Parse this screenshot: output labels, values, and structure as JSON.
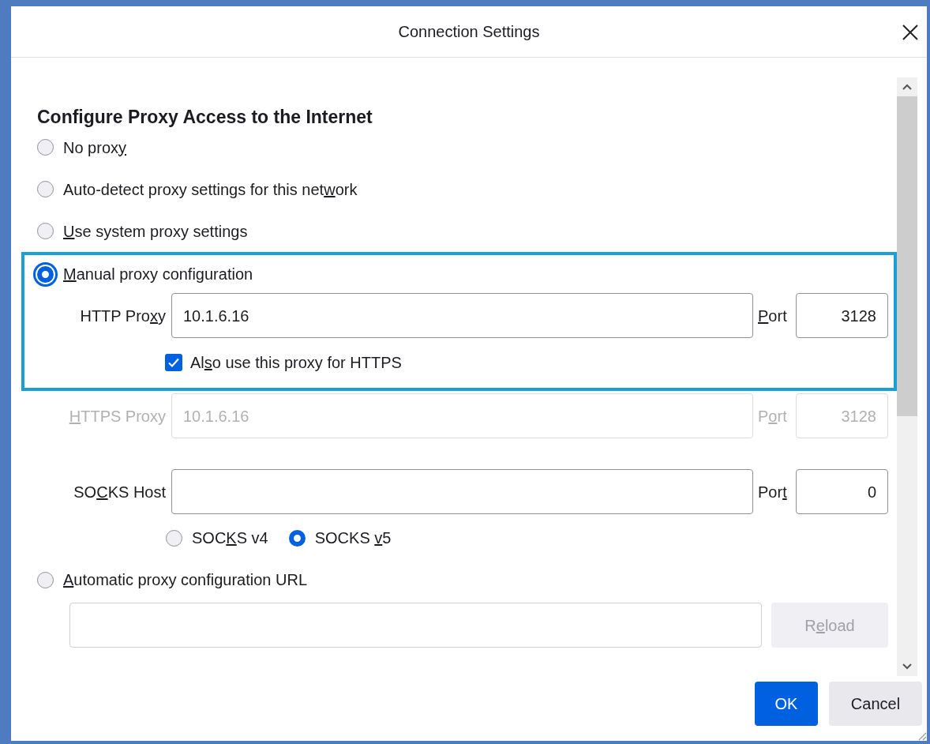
{
  "window": {
    "title": "Connection Settings"
  },
  "heading": "Configure Proxy Access to the Internet",
  "proxy_modes": [
    {
      "kind": "plain",
      "label": {
        "pre": "No prox",
        "key": "y"
      },
      "selected": false
    },
    {
      "kind": "plain",
      "label": {
        "pre": "Auto-detect proxy settings for this net",
        "key": "w",
        "post": "ork"
      },
      "selected": false
    },
    {
      "kind": "plain",
      "label": {
        "key": "U",
        "post": "se system proxy settings"
      },
      "selected": false
    },
    {
      "kind": "manual",
      "label": {
        "key": "M",
        "post": "anual proxy configuration"
      },
      "selected": true,
      "focused": true,
      "highlighted": true,
      "http_proxy": {
        "label": {
          "pre": "HTTP Pro",
          "key": "x",
          "post": "y"
        },
        "value": "10.1.6.16",
        "port_label": {
          "key": "P",
          "post": "ort"
        },
        "port": "3128"
      },
      "also_https": {
        "label": {
          "pre": "Al",
          "key": "s",
          "post": "o use this proxy for HTTPS"
        },
        "checked": true
      },
      "https_proxy": {
        "label": {
          "key": "H",
          "post": "TTPS Proxy"
        },
        "value": "10.1.6.16",
        "port_label": {
          "pre": "P",
          "key": "o",
          "post": "rt"
        },
        "port": "3128",
        "disabled": true
      },
      "socks_host": {
        "label": {
          "pre": "SO",
          "key": "C",
          "post": "KS Host"
        },
        "port_label": {
          "pre": "Por",
          "key": "t"
        },
        "port": "0"
      },
      "socks_versions": [
        {
          "label": {
            "pre": "SOC",
            "key": "K",
            "post": "S v4"
          },
          "selected": false
        },
        {
          "label": {
            "pre": "SOCKS ",
            "key": "v",
            "post": "5"
          },
          "selected": true
        }
      ]
    },
    {
      "kind": "auto_url",
      "label": {
        "key": "A",
        "post": "utomatic proxy configuration URL"
      },
      "selected": false,
      "reload": {
        "label": {
          "pre": "R",
          "key": "e",
          "post": "load"
        },
        "disabled": true
      }
    }
  ],
  "buttons": [
    {
      "label": "OK",
      "kind": "primary"
    },
    {
      "label": "Cancel",
      "kind": "secondary"
    }
  ]
}
